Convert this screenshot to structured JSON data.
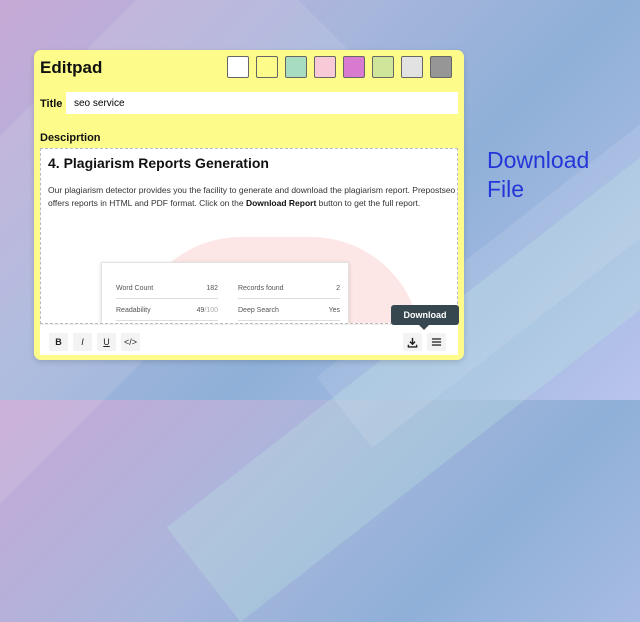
{
  "editor": {
    "brand": "Editpad",
    "swatches": [
      "#ffffff",
      "#fdfc8a",
      "#a8dcc0",
      "#f8c9d6",
      "#d77ad0",
      "#cfe69a",
      "#e2e2e2",
      "#969696"
    ],
    "background": "#fdfc8a",
    "title_label": "Title",
    "title_value": "seo service",
    "description_label": "Desciprtion",
    "content": {
      "heading": "4. Plagiarism Reports Generation",
      "paragraph_part1": "Our plagiarism detector provides you the facility to generate and download the plagiarism report. Prepostseo offers reports in HTML and PDF format. Click on the ",
      "paragraph_bold": "Download Report",
      "paragraph_part2": " button to get the full report."
    },
    "report_preview": {
      "word_count_label": "Word Count",
      "word_count_value": "182",
      "records_found_label": "Records found",
      "records_found_value": "2",
      "readability_label": "Readability",
      "readability_value": "49",
      "readability_max": "/100",
      "deep_search_label": "Deep Search",
      "deep_search_value": "Yes"
    },
    "toolbar": {
      "bold": "B",
      "italic": "I",
      "underline": "U",
      "code": "</>"
    },
    "download_tooltip": "Download"
  },
  "callout": {
    "line1": "Download",
    "line2": "File",
    "color": "#2536d8"
  },
  "icons": {
    "download": "download-icon",
    "menu": "menu-icon"
  }
}
